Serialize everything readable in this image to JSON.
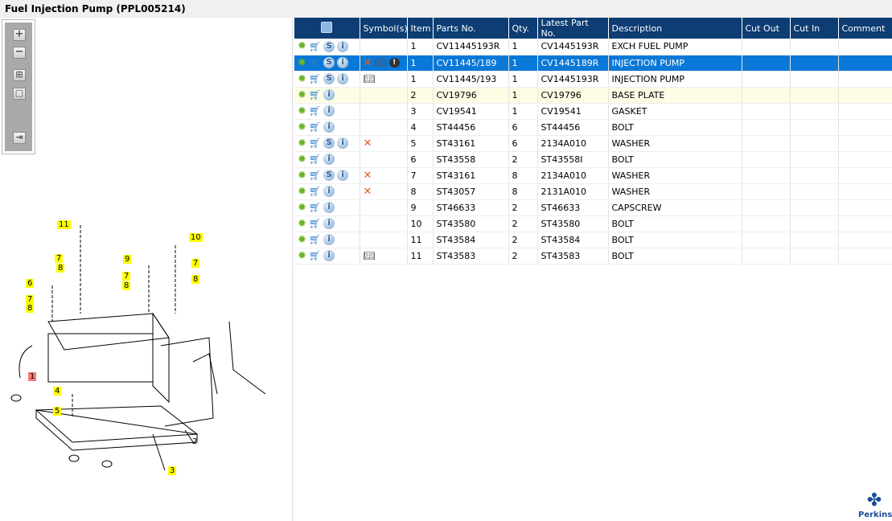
{
  "title": "Fuel Injection Pump (PPL005214)",
  "toolbar": {
    "zoom_in": "+",
    "zoom_out": "−",
    "fit": "⊞",
    "actual": "□",
    "export": "⇥"
  },
  "diagram": {
    "callouts": [
      "11",
      "7",
      "8",
      "9",
      "10",
      "7",
      "8",
      "7",
      "8",
      "6",
      "7",
      "8",
      "1",
      "4",
      "5",
      "2",
      "3"
    ]
  },
  "table": {
    "headers": [
      "",
      "Symbol(s)",
      "Item",
      "Parts No.",
      "Qty.",
      "Latest Part No.",
      "Description",
      "Cut Out",
      "Cut In",
      "Comment"
    ],
    "rows": [
      {
        "s": true,
        "sym": [],
        "item": "1",
        "part": "CV11445193R",
        "qty": "1",
        "latest": "CV1445193R",
        "desc": "EXCH FUEL PUMP"
      },
      {
        "s": true,
        "sym": [
          "x",
          "book",
          "alert"
        ],
        "item": "1",
        "part": "CV11445/189",
        "qty": "1",
        "latest": "CV1445189R",
        "desc": "INJECTION PUMP",
        "state": "sel"
      },
      {
        "s": true,
        "sym": [
          "book"
        ],
        "item": "1",
        "part": "CV11445/193",
        "qty": "1",
        "latest": "CV1445193R",
        "desc": "INJECTION PUMP"
      },
      {
        "s": false,
        "sym": [],
        "item": "2",
        "part": "CV19796",
        "qty": "1",
        "latest": "CV19796",
        "desc": "BASE PLATE",
        "state": "hl"
      },
      {
        "s": false,
        "sym": [],
        "item": "3",
        "part": "CV19541",
        "qty": "1",
        "latest": "CV19541",
        "desc": "GASKET"
      },
      {
        "s": false,
        "sym": [],
        "item": "4",
        "part": "ST44456",
        "qty": "6",
        "latest": "ST44456",
        "desc": "BOLT"
      },
      {
        "s": true,
        "sym": [
          "x"
        ],
        "item": "5",
        "part": "ST43161",
        "qty": "6",
        "latest": "2134A010",
        "desc": "WASHER"
      },
      {
        "s": false,
        "sym": [],
        "item": "6",
        "part": "ST43558",
        "qty": "2",
        "latest": "ST43558I",
        "desc": "BOLT"
      },
      {
        "s": true,
        "sym": [
          "x"
        ],
        "item": "7",
        "part": "ST43161",
        "qty": "8",
        "latest": "2134A010",
        "desc": "WASHER"
      },
      {
        "s": false,
        "sym": [
          "x"
        ],
        "item": "8",
        "part": "ST43057",
        "qty": "8",
        "latest": "2131A010",
        "desc": "WASHER"
      },
      {
        "s": false,
        "sym": [],
        "item": "9",
        "part": "ST46633",
        "qty": "2",
        "latest": "ST46633",
        "desc": "CAPSCREW"
      },
      {
        "s": false,
        "sym": [],
        "item": "10",
        "part": "ST43580",
        "qty": "2",
        "latest": "ST43580",
        "desc": "BOLT"
      },
      {
        "s": false,
        "sym": [],
        "item": "11",
        "part": "ST43584",
        "qty": "2",
        "latest": "ST43584",
        "desc": "BOLT"
      },
      {
        "s": false,
        "sym": [
          "book"
        ],
        "item": "11",
        "part": "ST43583",
        "qty": "2",
        "latest": "ST43583",
        "desc": "BOLT"
      }
    ]
  },
  "logo": {
    "text": "Perkins"
  }
}
